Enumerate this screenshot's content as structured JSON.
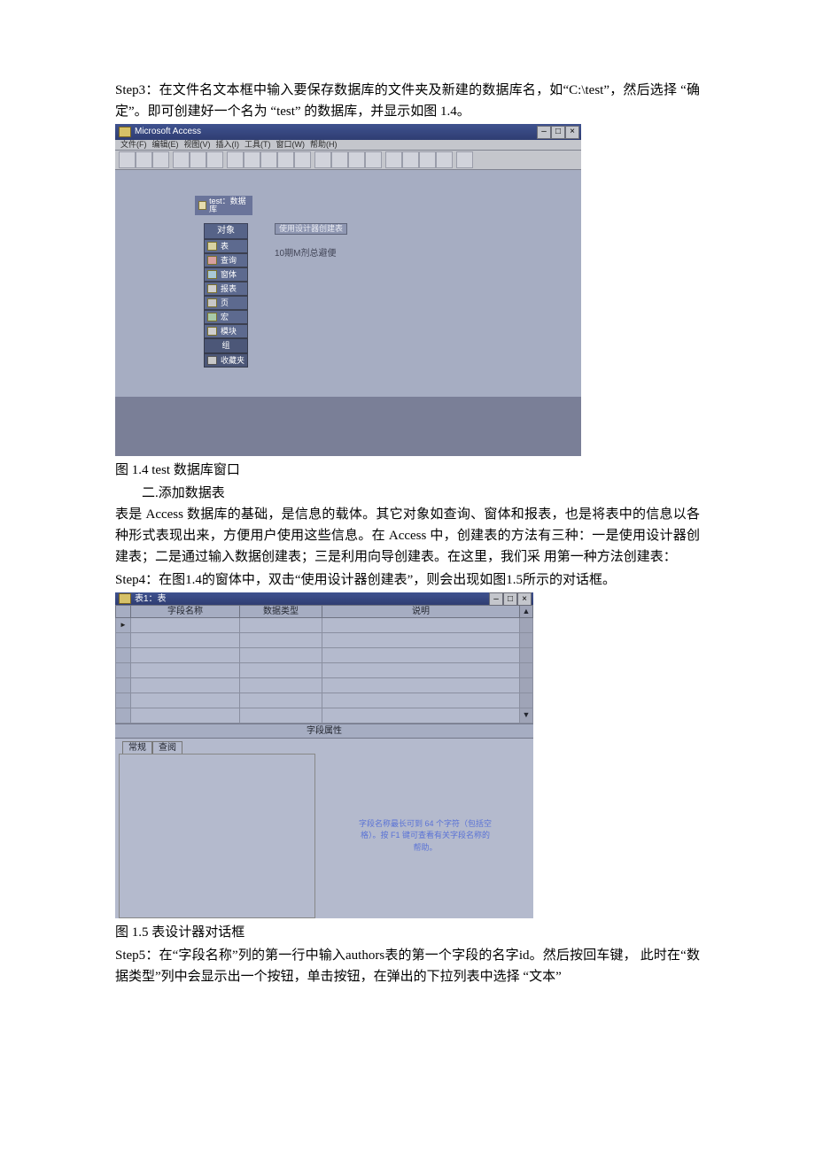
{
  "step3": "Step3：在文件名文本框中输入要保存数据库的文件夹及新建的数据库名，如“C:\\test”，然后选择 “确定”。即可创建好一个名为 “test” 的数据库，并显示如图 1.4。",
  "fig14": {
    "app_title": "Microsoft Access",
    "menus": [
      "文件(F)",
      "编辑(E)",
      "视图(V)",
      "插入(I)",
      "工具(T)",
      "窗口(W)",
      "帮助(H)"
    ],
    "dbwin_title": "test：数据库",
    "side_head": "对象",
    "side_items": [
      "表",
      "查询",
      "窗体",
      "报表",
      "页",
      "宏",
      "模块"
    ],
    "side_foot1": "组",
    "side_foot2": "收藏夹",
    "main_button": "使用设计器创建表",
    "main_text": "10期M剂总避便",
    "caption": "图 1.4 test 数据库窗口"
  },
  "subhead": "二.添加数据表",
  "para1": "表是 Access 数据库的基础，是信息的载体。其它对象如查询、窗体和报表，也是将表中的信息以各种形式表现出来，方便用户使用这些信息。在 Access 中，创建表的方法有三种：一是使用设计器创建表；二是通过输入数据创建表；三是利用向导创建表。在这里，我们采 用第一种方法创建表：",
  "step4": "Step4：在图1.4的窗体中，双击“使用设计器创建表”，则会出现如图1.5所示的对话框。",
  "fig15": {
    "win_title": "表1：表",
    "col1": "字段名称",
    "col2": "数据类型",
    "col3": "说明",
    "band": "字段属性",
    "tab1": "常规",
    "tab2": "查阅",
    "hint": "字段名称最长可到 64 个字符（包括空格）。按 F1 键可查看有关字段名称的帮助。",
    "caption": "图 1.5 表设计器对话框"
  },
  "step5": "Step5：在“字段名称”列的第一行中输入authors表的第一个字段的名字id。然后按回车键，  此时在“数据类型”列中会显示出一个按钮，单击按钮，在弹出的下拉列表中选择 “文本”"
}
